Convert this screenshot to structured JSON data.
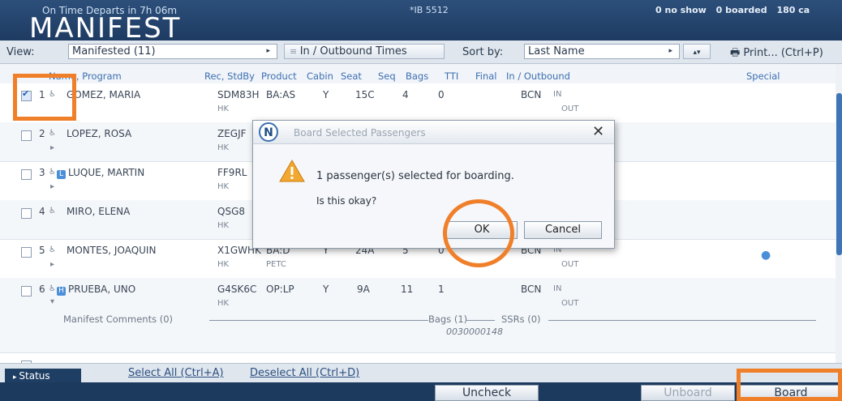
{
  "header": {
    "status_line": "On Time   Departs in 7h 06m",
    "flight": "*IB 5512",
    "app_title": "MANIFEST",
    "stats": {
      "no_show": "0 no show",
      "boarded": "0 boarded",
      "capacity": "180 ca"
    }
  },
  "toolbar": {
    "view_label": "View:",
    "view_value": "Manifested (11)",
    "times_button": "In / Outbound Times",
    "sort_label": "Sort by:",
    "sort_value": "Last Name",
    "print_button": "Print... (Ctrl+P)"
  },
  "columns": [
    "Name, Program",
    "Rec, StdBy",
    "Product",
    "Cabin",
    "Seat",
    "Seq",
    "Bags",
    "TTI",
    "Final",
    "In / Outbound",
    "Special"
  ],
  "passengers": [
    {
      "num": "1",
      "name": "GOMEZ, MARIA",
      "rec": "SDM83H",
      "stdby": "HK",
      "product": "BA:AS",
      "cabin": "Y",
      "seat": "15C",
      "seq": "4",
      "bags": "0",
      "final": "BCN",
      "in": "IN",
      "out": "OUT",
      "checked": true
    },
    {
      "num": "2",
      "name": "LOPEZ, ROSA",
      "rec": "ZEGJF",
      "stdby": "HK",
      "checked": false
    },
    {
      "num": "3",
      "name": "LUQUE, MARTIN",
      "rec": "FF9RL",
      "stdby": "HK",
      "badge": "L",
      "checked": false
    },
    {
      "num": "4",
      "name": "MIRO, ELENA",
      "rec": "QSG8",
      "stdby": "HK",
      "checked": false
    },
    {
      "num": "5",
      "name": "MONTES, JOAQUIN",
      "rec": "X1GWHK",
      "stdby": "HK",
      "product": "BA:D",
      "product2": "PETC",
      "cabin": "Y",
      "seat": "24A",
      "seq": "5",
      "bags": "0",
      "final": "BCN",
      "in": "IN",
      "out": "OUT",
      "checked": false
    },
    {
      "num": "6",
      "name": "PRUEBA, UNO",
      "rec": "G4SK6C",
      "stdby": "HK",
      "product": "OP:LP",
      "cabin": "Y",
      "seat": "9A",
      "seq": "11",
      "bags": "1",
      "final": "BCN",
      "in": "IN",
      "out": "OUT",
      "badge": "H",
      "checked": false
    }
  ],
  "details": {
    "comments": "Manifest Comments (0)",
    "bags": "Bags (1)",
    "bag_tag": "0030000148",
    "ssrs": "SSRs (0)"
  },
  "status": {
    "tab": "Status",
    "select_all": "Select All",
    "select_all_shortcut": "(Ctrl+A)",
    "deselect_all": "Deselect All",
    "deselect_all_shortcut": "(Ctrl+D)"
  },
  "bottom_buttons": {
    "uncheck": "Uncheck",
    "unboard": "Unboard",
    "board": "Board"
  },
  "dialog": {
    "title": "Board Selected Passengers",
    "logo": "N",
    "message": "1 passenger(s) selected for boarding.",
    "question": "Is this okay?",
    "ok": "OK",
    "cancel": "Cancel"
  },
  "colors": {
    "highlight": "#f07f2a",
    "header": "#1e3b62",
    "link": "#3d6fb3"
  },
  "icons": [
    "checkbox-icon",
    "person-icon",
    "expand-arrow-icon",
    "warning-icon",
    "close-icon",
    "printer-icon",
    "dropdown-arrow-icon",
    "chat-icon"
  ]
}
